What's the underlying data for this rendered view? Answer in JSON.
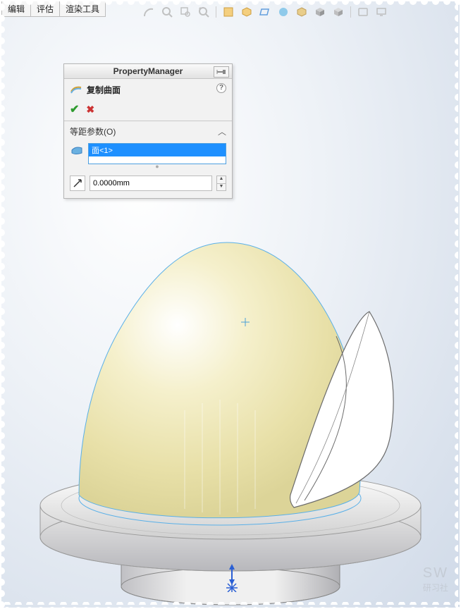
{
  "tabs": {
    "t0": "编辑",
    "t1": "评估",
    "t2": "渲染工具"
  },
  "pm": {
    "title": "PropertyManager",
    "feature_label": "复制曲面",
    "help": "?",
    "section_label": "等距参数(O)",
    "selected_face": "面<1>",
    "distance_value": "0.0000mm"
  },
  "watermark": {
    "line1": "SW",
    "line2": "研习社"
  },
  "toolbar_icons": [
    "arc-icon",
    "zoom-fit-icon",
    "zoom-area-icon",
    "zoom-prev-icon",
    "section-icon",
    "view-orient-icon",
    "display-style-icon",
    "scene-icon",
    "shadow-icon",
    "iso-cube-icon",
    "iso-cube2-icon",
    "render-icon",
    "screen-icon"
  ]
}
